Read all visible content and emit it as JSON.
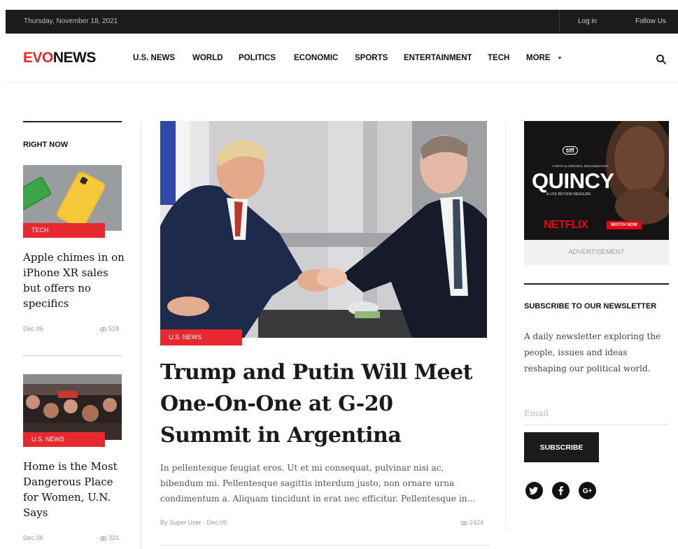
{
  "topbar": {
    "date": "Thursday, November 18, 2021",
    "login": "Log in",
    "follow": "Follow Us"
  },
  "logo": {
    "evo": "EVO",
    "news": "NEWS"
  },
  "nav": [
    "U.S. NEWS",
    "WORLD",
    "POLITICS",
    "ECONOMIC",
    "SPORTS",
    "ENTERTAINMENT",
    "TECH",
    "MORE"
  ],
  "nav_more_icon": "caret-down-icon",
  "sidebar": {
    "title": "RIGHT NOW",
    "items": [
      {
        "tag": "TECH",
        "title": "Apple chimes in on iPhone XR sales but offers no specifics",
        "date": "Dec.06",
        "views": "518"
      },
      {
        "tag": "U.S. NEWS",
        "title": "Home is the Most Dangerous Place for Women, U.N. Says",
        "date": "Dec.06",
        "views": "321"
      }
    ]
  },
  "featured": {
    "tag": "U.S. NEWS",
    "title": "Trump and Putin Will Meet One-On-One at G-20 Summit in Argentina",
    "excerpt": "In pellentesque feugiat eros. Ut et mi consequat, pulvinar nisi ac, bibendum mi. Pellentesque sagittis interdum justo, non ornare urna condimentum a. Aliquam tincidunt in erat nec efficitur. Pellentesque in...",
    "byline": "By Super User · Dec.06",
    "views": "2424"
  },
  "ad": {
    "badge": "tiff",
    "kicker": "A NETFLIX ORIGINAL DOCUMENTARY",
    "title": "QUINCY",
    "subtitle": "A LIFE BEYOND MEASURE",
    "brand": "NETFLIX",
    "cta": "WATCH NOW",
    "label": "ADVERTISEMENT"
  },
  "newsletter": {
    "title": "SUBSCRIBE TO OUR NEWSLETTER",
    "text": "A daily newsletter exploring the people, issues and ideas reshaping our political world.",
    "placeholder": "Email",
    "button": "SUBSCRIBE"
  },
  "social": [
    "twitter-icon",
    "facebook-icon",
    "google-plus-icon"
  ],
  "colors": {
    "accent": "#e8282f",
    "dark": "#1b1b1b"
  }
}
